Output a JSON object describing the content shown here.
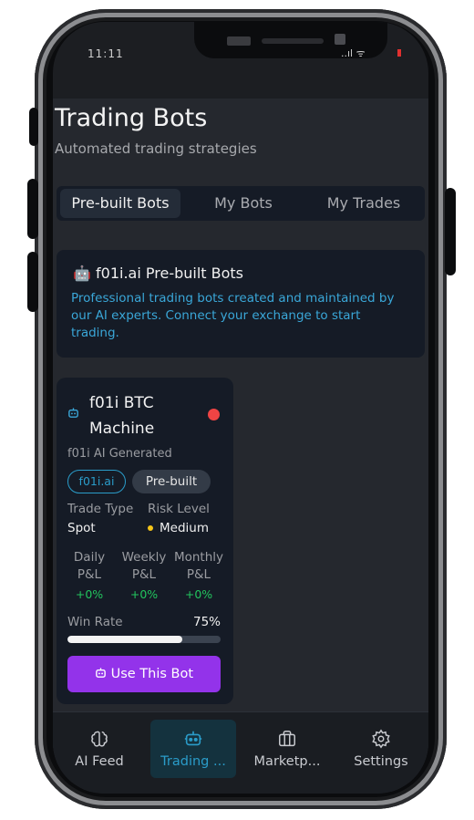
{
  "status_bar": {
    "time": "11:11",
    "icons": "..ıl ᯤ"
  },
  "header": {
    "title": "Trading Bots",
    "subtitle": "Automated trading strategies"
  },
  "tabs": [
    {
      "label": "Pre-built Bots",
      "active": true
    },
    {
      "label": "My Bots",
      "active": false
    },
    {
      "label": "My Trades",
      "active": false
    }
  ],
  "info_box": {
    "icon": "robot-icon",
    "title": "f01i.ai Pre-built Bots",
    "description": "Professional trading bots created and maintained by our AI experts. Connect your exchange to start trading."
  },
  "bot_card": {
    "name": "f01i BTC Machine",
    "status_color": "#ef4444",
    "generated_by": "f01i AI Generated",
    "tags": [
      "f01i.ai",
      "Pre-built"
    ],
    "trade_type_label": "Trade Type",
    "trade_type_value": "Spot",
    "risk_label": "Risk Level",
    "risk_value": "Medium",
    "pnl": [
      {
        "label": "Daily P&L",
        "value": "+0%"
      },
      {
        "label": "Weekly P&L",
        "value": "+0%"
      },
      {
        "label": "Monthly P&L",
        "value": "+0%"
      }
    ],
    "win_rate_label": "Win Rate",
    "win_rate_value": "75%",
    "win_rate_fraction": 0.75,
    "use_button_label": "Use This Bot"
  },
  "bottom_nav": [
    {
      "label": "AI Feed",
      "icon": "brain-icon",
      "active": false
    },
    {
      "label": "Trading ...",
      "icon": "robot-icon",
      "active": true
    },
    {
      "label": "Marketp...",
      "icon": "briefcase-icon",
      "active": false
    },
    {
      "label": "Settings",
      "icon": "gear-icon",
      "active": false
    }
  ],
  "colors": {
    "accent": "#2a9cc9",
    "button": "#9333ea",
    "positive": "#22c55e",
    "risk_dot": "#f5c518"
  }
}
